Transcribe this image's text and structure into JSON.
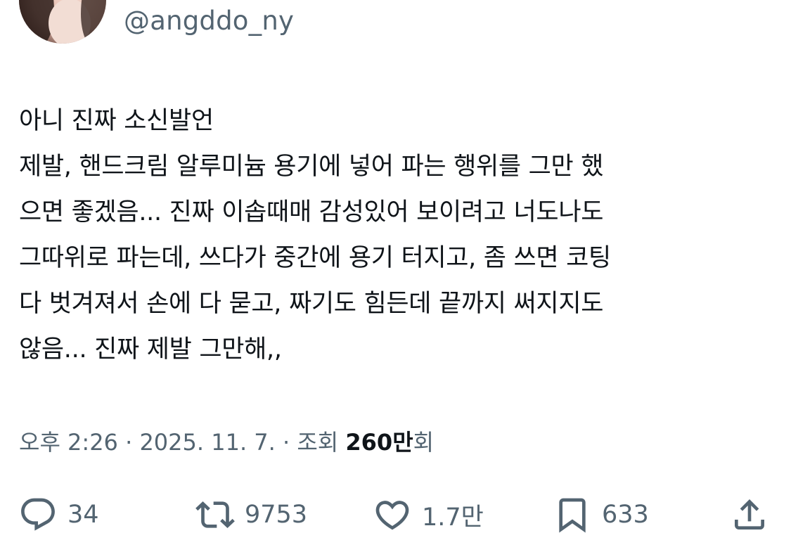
{
  "author": {
    "handle": "@angddo_ny",
    "avatar_icon": "avatar"
  },
  "tweet": {
    "lines": [
      "아니 진짜 소신발언",
      "제발, 핸드크림 알루미늄 용기에 넣어 파는 행위를 그만 했",
      "으면 좋겠음... 진짜 이솝때매 감성있어 보이려고 너도나도",
      "그따위로 파는데, 쓰다가 중간에 용기 터지고, 좀 쓰면 코팅",
      "다 벗겨져서 손에 다 묻고, 짜기도 힘든데 끝까지 써지지도",
      "않음... 진짜 제발 그만해,,"
    ]
  },
  "meta": {
    "time": "오후 2:26",
    "separator": " · ",
    "date": "2025. 11. 7.",
    "views_label": "조회",
    "views_count": "260만",
    "views_suffix": "회"
  },
  "actions": {
    "reply": {
      "icon": "reply-icon",
      "count": "34"
    },
    "retweet": {
      "icon": "retweet-icon",
      "count": "9753"
    },
    "like": {
      "icon": "heart-icon",
      "count": "1.7만"
    },
    "bookmark": {
      "icon": "bookmark-icon",
      "count": "633"
    },
    "share": {
      "icon": "share-icon"
    }
  },
  "colors": {
    "text": "#0f1419",
    "secondary": "#536471",
    "background": "#ffffff"
  }
}
